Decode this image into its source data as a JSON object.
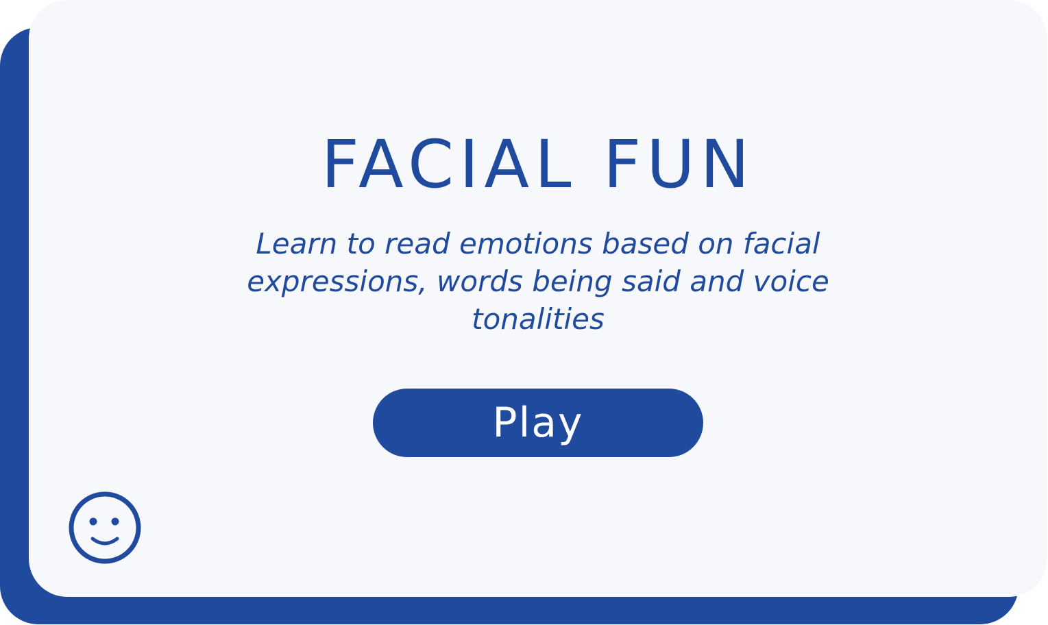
{
  "card": {
    "title": "FACIAL FUN",
    "description": "Learn to read emotions based on facial expressions, words being said and voice tonalities",
    "play_label": "Play",
    "icon": "smiley-face-icon"
  },
  "colors": {
    "accent": "#1f4a9e",
    "card_background": "#f7f8fb",
    "button_text": "#ffffff"
  }
}
